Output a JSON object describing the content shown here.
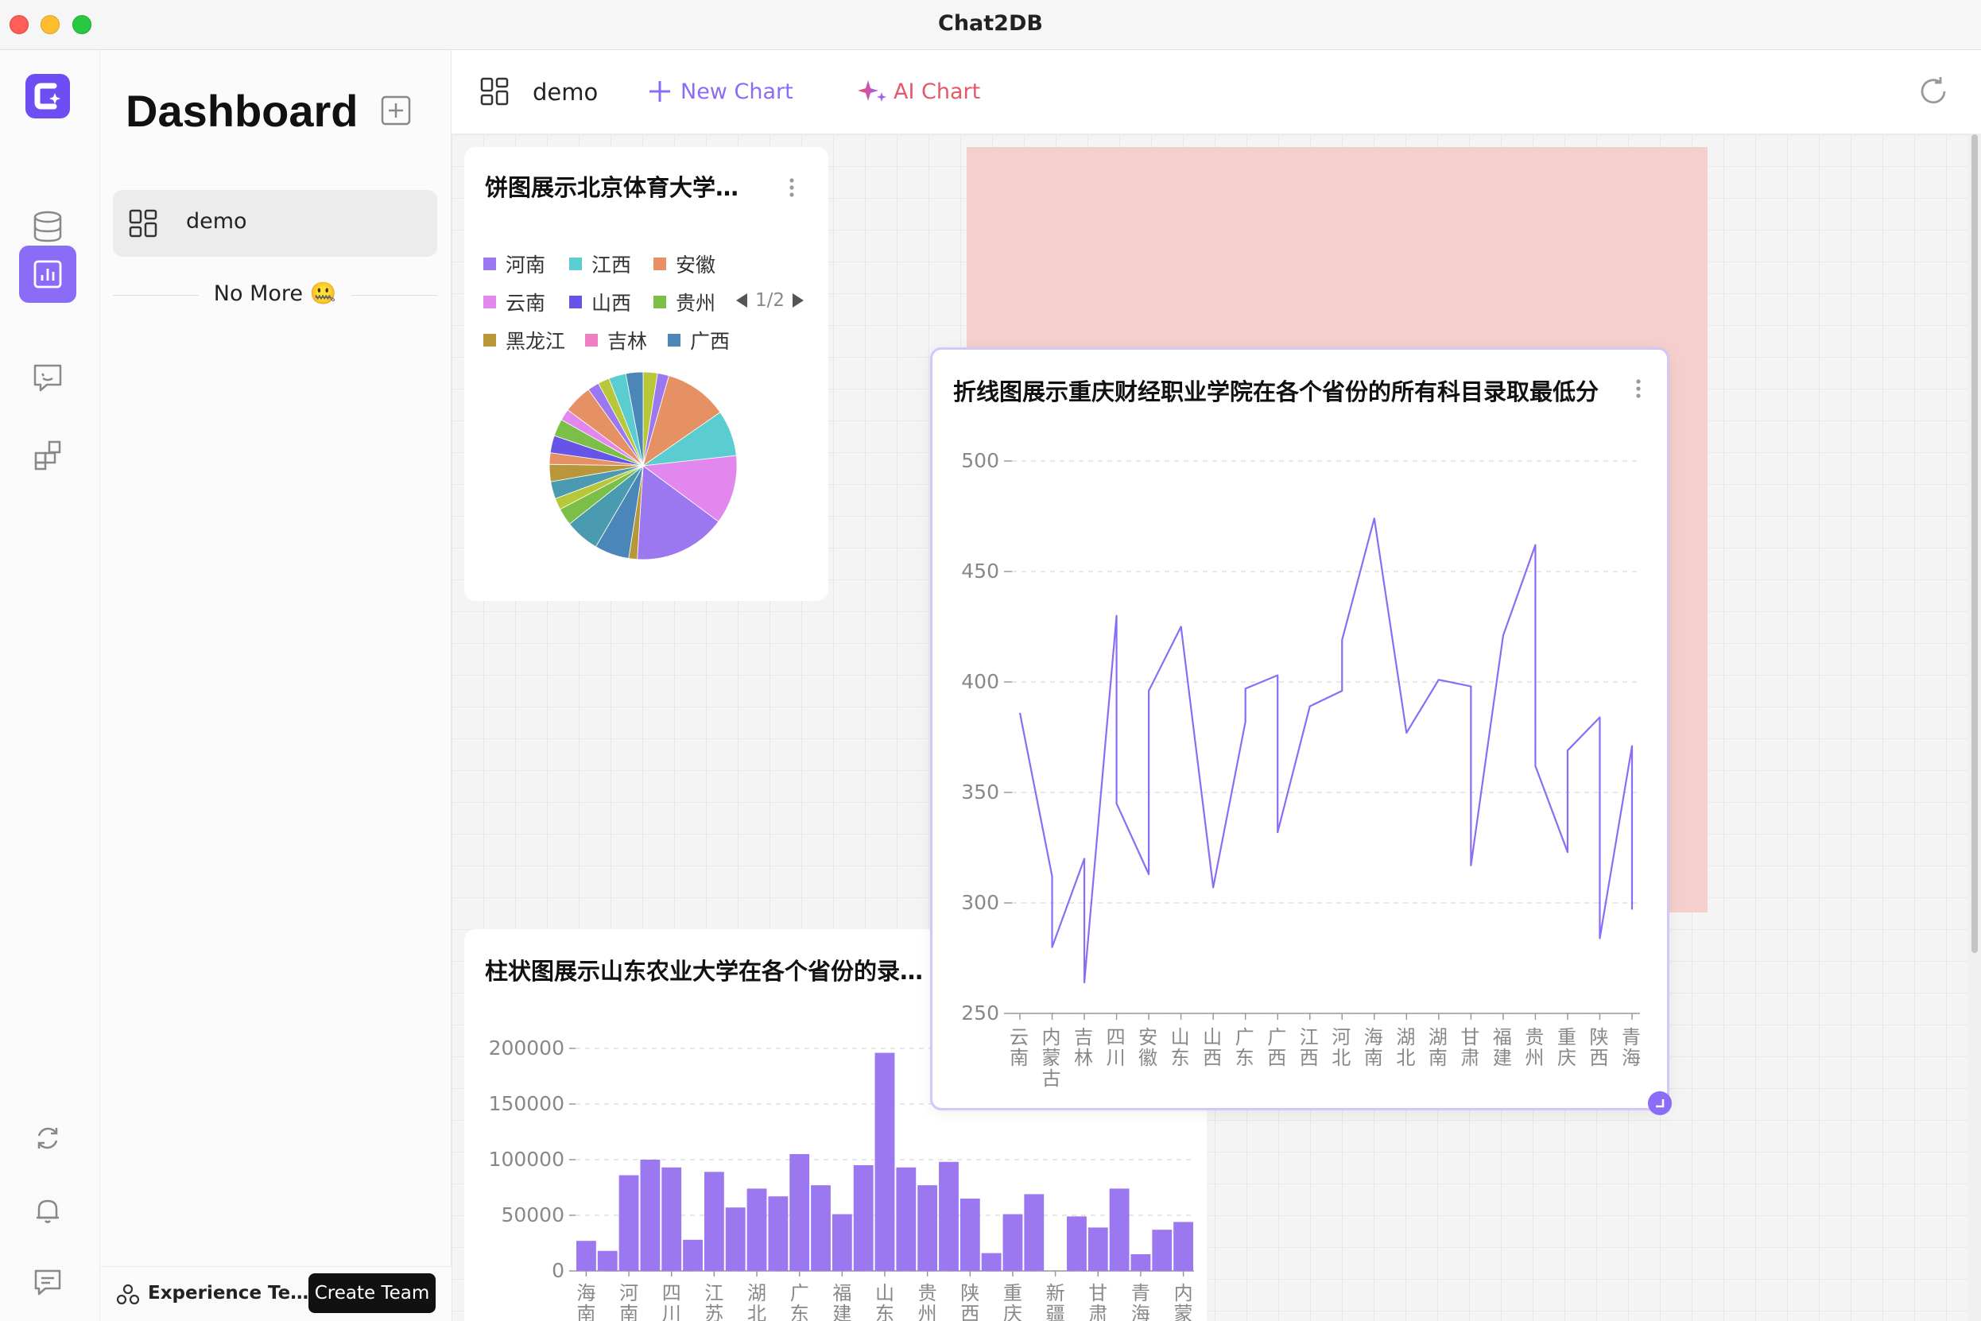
{
  "window": {
    "title": "Chat2DB"
  },
  "sidebar": {
    "title": "Dashboard",
    "items": [
      {
        "label": "demo"
      }
    ],
    "no_more": "No More 🤐",
    "team_label": "Experience Team ...",
    "create_team": "Create Team"
  },
  "header": {
    "dashboard_name": "demo",
    "new_chart": "New Chart",
    "ai_chart": "AI Chart"
  },
  "rail": {
    "icons": [
      "database-icon",
      "dashboard-icon",
      "chat-icon",
      "plugins-icon",
      "sync-icon",
      "bell-icon",
      "feedback-icon"
    ]
  },
  "colors": {
    "accent": "#8b6cf6",
    "ai_gradient_start": "#ef4a6b",
    "pink_block": "#f4cfcb"
  },
  "charts": {
    "pie": {
      "title": "饼图展示北京体育大学...",
      "pager": "1/2"
    },
    "line": {
      "title": "折线图展示重庆财经职业学院在各个省份的所有科目录取最低分"
    },
    "bar": {
      "title": "柱状图展示山东农业大学在各个省份的录取最"
    }
  },
  "chart_data": [
    {
      "type": "pie",
      "title": "饼图展示北京体育大学...",
      "legend": [
        {
          "name": "河南",
          "color": "#9b78f0"
        },
        {
          "name": "江西",
          "color": "#5bcdd0"
        },
        {
          "name": "安徽",
          "color": "#e69164"
        },
        {
          "name": "云南",
          "color": "#e187ee"
        },
        {
          "name": "山西",
          "color": "#6554e6"
        },
        {
          "name": "贵州",
          "color": "#7cbf48"
        },
        {
          "name": "黑龙江",
          "color": "#b8973a"
        },
        {
          "name": "吉林",
          "color": "#ef7fc4"
        },
        {
          "name": "广西",
          "color": "#4a86b8"
        }
      ],
      "slices": [
        {
          "value": 2.5,
          "color": "#b8c73a"
        },
        {
          "value": 2,
          "color": "#9b78f0"
        },
        {
          "value": 11,
          "color": "#e69164"
        },
        {
          "value": 8,
          "color": "#5bcdd0"
        },
        {
          "value": 12,
          "color": "#e187ee"
        },
        {
          "value": 16,
          "color": "#9b78f0"
        },
        {
          "value": 1.5,
          "color": "#b8973a"
        },
        {
          "value": 6,
          "color": "#4a86b8"
        },
        {
          "value": 6,
          "color": "#4a9bb0"
        },
        {
          "value": 3,
          "color": "#7cbf48"
        },
        {
          "value": 2,
          "color": "#b8c73a"
        },
        {
          "value": 3,
          "color": "#4a9bb0"
        },
        {
          "value": 3,
          "color": "#b8973a"
        },
        {
          "value": 2,
          "color": "#e69164"
        },
        {
          "value": 3,
          "color": "#6554e6"
        },
        {
          "value": 3,
          "color": "#7cbf48"
        },
        {
          "value": 2,
          "color": "#e187ee"
        },
        {
          "value": 5,
          "color": "#e69164"
        },
        {
          "value": 2,
          "color": "#9b78f0"
        },
        {
          "value": 2,
          "color": "#b8c73a"
        },
        {
          "value": 3,
          "color": "#5bcdd0"
        },
        {
          "value": 3,
          "color": "#4a86b8"
        }
      ]
    },
    {
      "type": "line",
      "title": "折线图展示重庆财经职业学院在各个省份的所有科目录取最低分",
      "ylim": [
        250,
        500
      ],
      "yticks": [
        250,
        300,
        350,
        400,
        450,
        500
      ],
      "categories": [
        "云南",
        "内蒙古",
        "吉林",
        "四川",
        "安徽",
        "山东",
        "山西",
        "广东",
        "广西",
        "江西",
        "河北",
        "海南",
        "湖北",
        "湖南",
        "甘肃",
        "福建",
        "贵州",
        "重庆",
        "陕西",
        "青海"
      ],
      "points": [
        [
          0,
          386
        ],
        [
          1,
          312
        ],
        [
          1,
          280
        ],
        [
          2,
          320
        ],
        [
          2,
          264
        ],
        [
          3,
          430
        ],
        [
          3,
          345
        ],
        [
          4,
          313
        ],
        [
          4,
          396
        ],
        [
          5,
          425
        ],
        [
          6,
          307
        ],
        [
          7,
          382
        ],
        [
          7,
          397
        ],
        [
          8,
          403
        ],
        [
          8,
          332
        ],
        [
          9,
          389
        ],
        [
          10,
          396
        ],
        [
          10,
          419
        ],
        [
          11,
          474
        ],
        [
          12,
          377
        ],
        [
          13,
          401
        ],
        [
          14,
          398
        ],
        [
          14,
          317
        ],
        [
          15,
          421
        ],
        [
          16,
          462
        ],
        [
          16,
          362
        ],
        [
          17,
          323
        ],
        [
          17,
          369
        ],
        [
          18,
          384
        ],
        [
          18,
          284
        ],
        [
          19,
          371
        ],
        [
          19,
          297
        ]
      ]
    },
    {
      "type": "bar",
      "title": "柱状图展示山东农业大学在各个省份的录取最",
      "ylim": [
        0,
        200000
      ],
      "yticks": [
        0,
        50000,
        100000,
        150000,
        200000
      ],
      "values": [
        27000,
        18000,
        86000,
        100000,
        93000,
        28000,
        89000,
        57000,
        74000,
        67000,
        105000,
        77000,
        51000,
        95000,
        196000,
        93000,
        77000,
        98000,
        65000,
        16000,
        51000,
        69000,
        0,
        49000,
        39000,
        74000,
        15000,
        37000,
        44000
      ],
      "labels": [
        "海南",
        "",
        "河南",
        "",
        "四川",
        "",
        "江苏",
        "",
        "湖北",
        "",
        "广东",
        "",
        "福建",
        "",
        "山东",
        "",
        "贵州",
        "",
        "陕西",
        "",
        "重庆",
        "",
        "新疆",
        "",
        "甘肃",
        "",
        "青海",
        "",
        "内蒙"
      ]
    }
  ]
}
